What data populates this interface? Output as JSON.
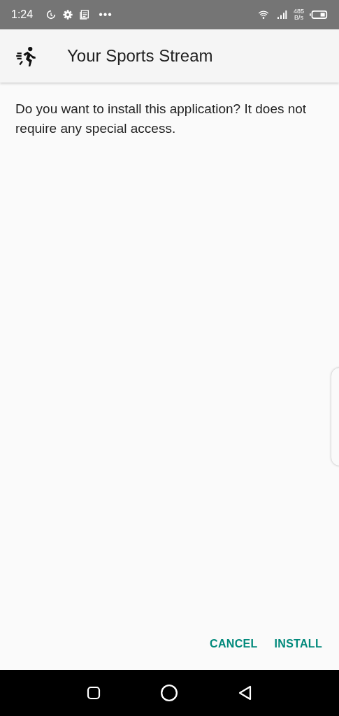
{
  "status_bar": {
    "time": "1:24",
    "more": "•••",
    "speed_value": "485",
    "speed_unit": "B/s"
  },
  "app_bar": {
    "title": "Your Sports Stream"
  },
  "message": "Do you want to install this application? It does not require any special access.",
  "buttons": [
    {
      "label": "CANCEL"
    },
    {
      "label": "INSTALL"
    }
  ]
}
